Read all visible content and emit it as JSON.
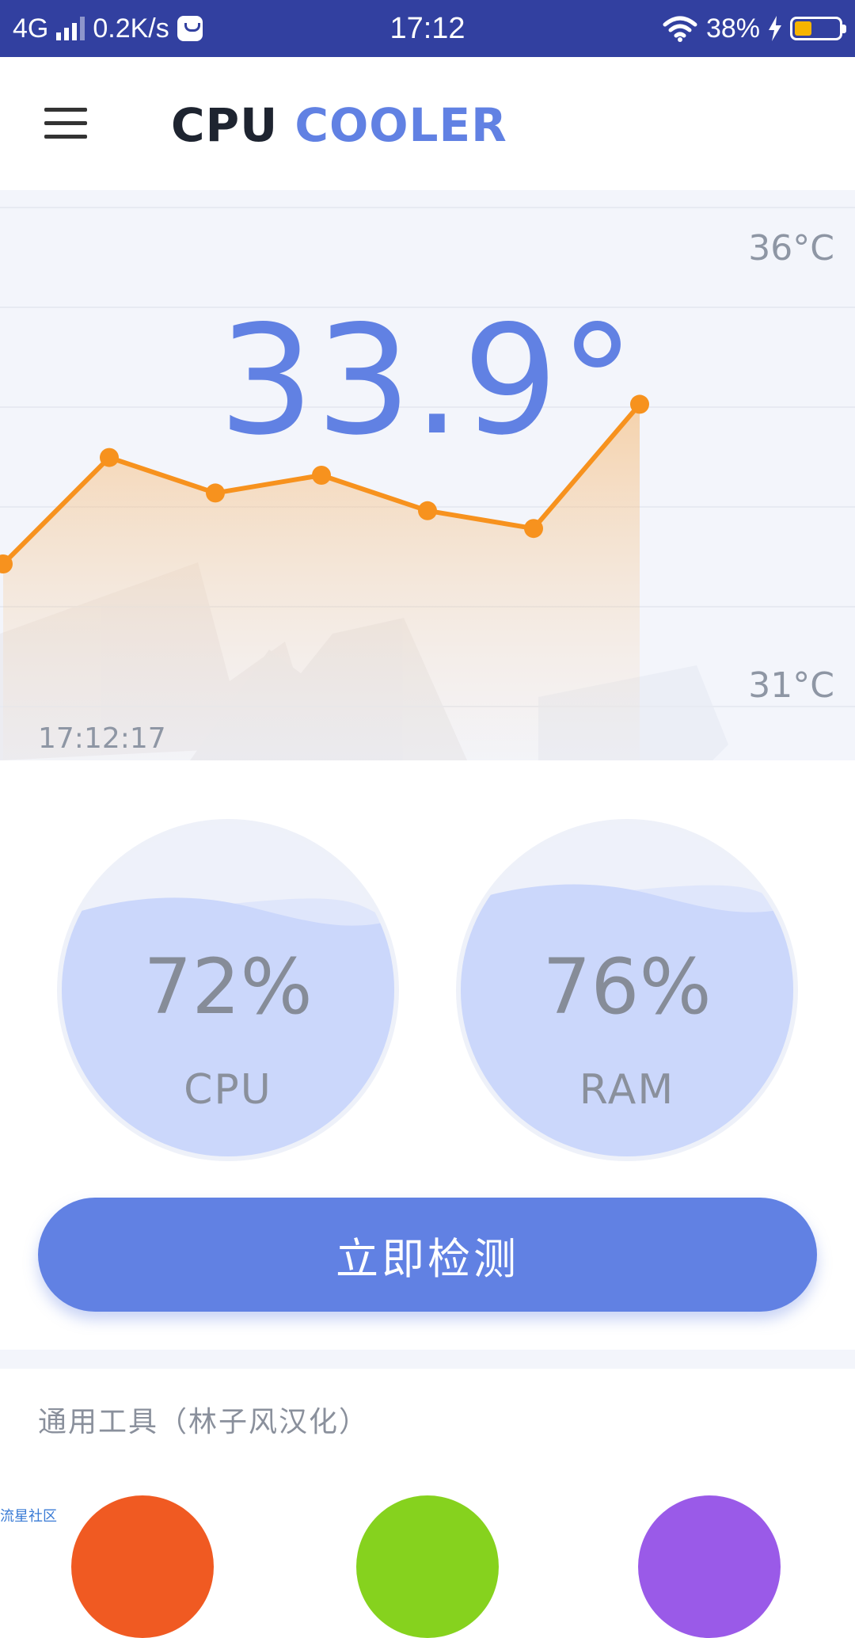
{
  "status_bar": {
    "network": "4G",
    "speed": "0.2K/s",
    "time": "17:12",
    "battery_percent": "38%",
    "battery_level": 0.38
  },
  "app_bar": {
    "title_part1": "CPU",
    "title_part2": "COOLER",
    "menu_icon": "hamburger-menu-icon"
  },
  "temperature": {
    "current": "33.9°",
    "max_label": "36°C",
    "min_label": "31°C",
    "time_label": "17:12:17"
  },
  "chart_data": {
    "type": "line",
    "series": [
      {
        "values": [
          32.5,
          33.7,
          33.3,
          33.5,
          33.1,
          32.9,
          34.3
        ]
      }
    ],
    "ylim": [
      31,
      36
    ],
    "grid": true
  },
  "gauges": [
    {
      "value": "72%",
      "label": "CPU",
      "level": 0.72
    },
    {
      "value": "76%",
      "label": "RAM",
      "level": 0.76
    }
  ],
  "scan_button": {
    "label": "立即检测"
  },
  "tools": {
    "title": "通用工具（林子风汉化）",
    "colors": [
      "#f05a22",
      "#86d21e",
      "#9a5ae8"
    ]
  },
  "watermark": {
    "text": "流星社区"
  },
  "colors": {
    "status_bar": "#3240a0",
    "accent": "#6181e3",
    "chart_line": "#f7921e",
    "gauge_fill": "#cbd7fb"
  }
}
